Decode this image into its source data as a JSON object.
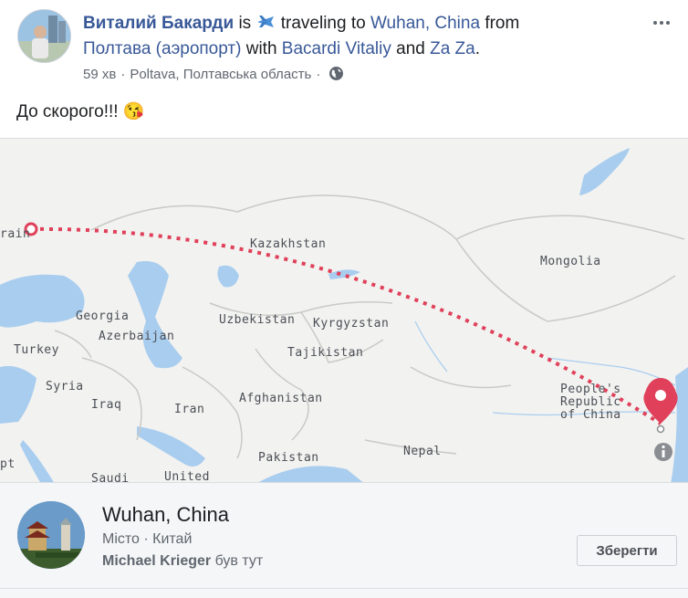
{
  "post": {
    "author": "Виталий Бакарди",
    "is_word": "is",
    "activity_text": "traveling to",
    "destination": "Wuhan, China",
    "from_word": "from",
    "origin": "Полтава (аэропорт)",
    "with_word": "with",
    "tag1": "Bacardi Vitaliy",
    "and_word": "and",
    "tag2": "Za Za",
    "period": ".",
    "time": "59 хв",
    "dot": "·",
    "location": "Poltava, Полтавська область",
    "body": "До скорого!!! 😘",
    "activity_icon": "airplane-icon",
    "privacy_icon": "globe-icon"
  },
  "map": {
    "labels": {
      "kazakhstan": "Kazakhstan",
      "mongolia": "Mongolia",
      "georgia": "Georgia",
      "uzbekistan": "Uzbekistan",
      "kyrgyzstan": "Kyrgyzstan",
      "azerbaijan": "Azerbaijan",
      "turkey": "Turkey",
      "tajikistan": "Tajikistan",
      "syria": "Syria",
      "iraq": "Iraq",
      "iran": "Iran",
      "afghanistan": "Afghanistan",
      "pakistan": "Pakistan",
      "nepal": "Nepal",
      "saudi": "Saudi",
      "united": "United",
      "egypt": "pt",
      "ukraine": "rain",
      "china1": "People's",
      "china2": "Republic",
      "china3": "of China"
    },
    "info_icon": "info-icon",
    "pin_icon": "map-pin-icon",
    "colors": {
      "route": "#e0405a",
      "water": "#a9cdef",
      "land": "#f2f2f0"
    }
  },
  "place": {
    "name": "Wuhan, China",
    "type": "Місто · Китай",
    "visitor": "Michael Krieger",
    "visited_text": "був тут",
    "save_label": "Зберегти"
  }
}
